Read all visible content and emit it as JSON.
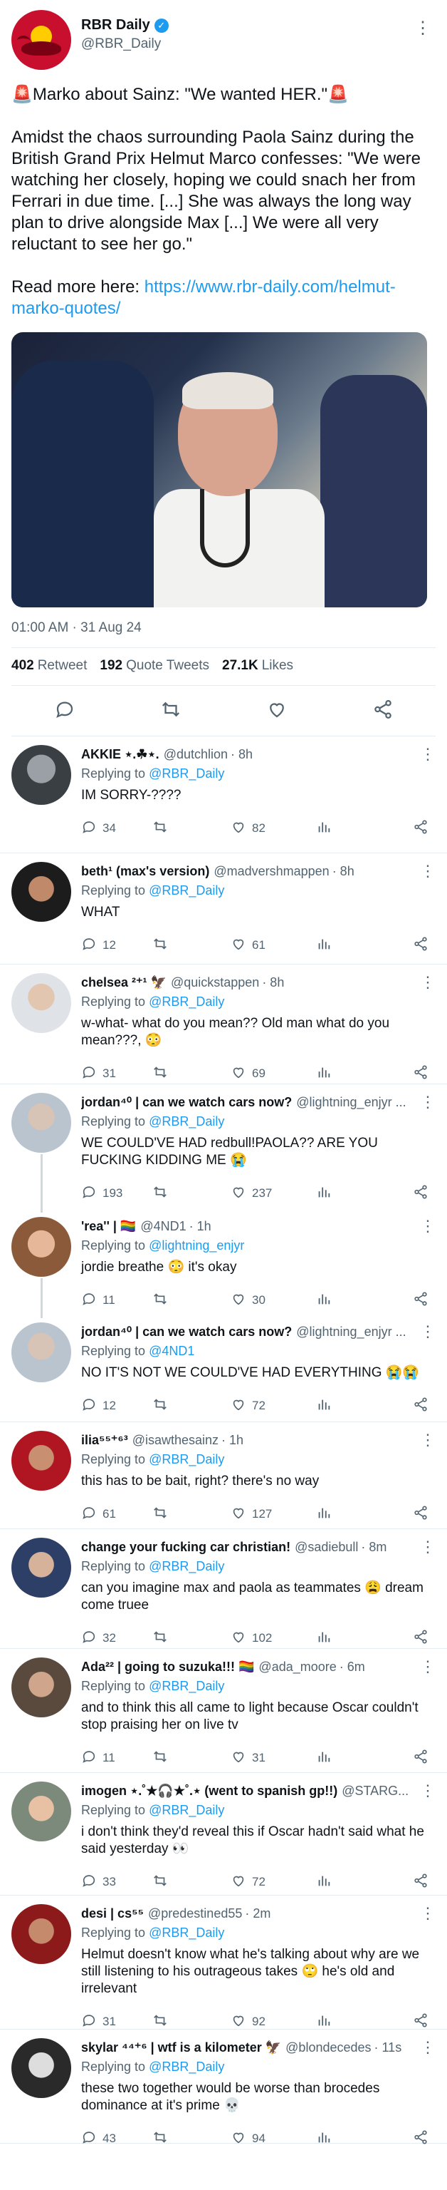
{
  "tweet": {
    "name": "RBR Daily",
    "handle": "@RBR_Daily",
    "title_line": "🚨Marko about Sainz: \"We wanted HER.\"🚨",
    "body": "Amidst the chaos surrounding Paola Sainz during the British Grand Prix Helmut Marco confesses: \"We were watching her closely, hoping we could snach her from Ferrari in due time. [...] She was always the long way plan to drive alongside Max [...] We were all very reluctant to see her go.\"",
    "read_more": "Read more here: ",
    "link": "https://www.rbr-daily.com/helmut-marko-quotes/",
    "timestamp": "01:00 AM · 31 Aug 24",
    "stats": {
      "retweets": "402",
      "retweets_label": "Retweet",
      "quotes": "192",
      "quotes_label": "Quote Tweets",
      "likes": "27.1K",
      "likes_label": "Likes"
    }
  },
  "colors": {
    "accent": "#1d9bf0",
    "muted": "#536471",
    "brand": "#c8102e"
  },
  "replies": [
    {
      "name": "AKKIE ⋆.☘︎⋆.",
      "handle": "@dutchlion",
      "time": "· 8h",
      "replying_prefix": "Replying to ",
      "replying_to": "@RBR_Daily",
      "text": "IM SORRY-????",
      "replies": "34",
      "likes": "82"
    },
    {
      "name": "beth¹ (max's version)",
      "handle": "@madvershmappen",
      "time": "· 8h",
      "replying_prefix": "Replying to ",
      "replying_to": "@RBR_Daily",
      "text": "WHAT",
      "replies": "12",
      "likes": "61"
    },
    {
      "name": "chelsea ²⁺¹ 🦅",
      "handle": "@quickstappen",
      "time": "· 8h",
      "replying_prefix": "Replying to ",
      "replying_to": "@RBR_Daily",
      "text": "w-what- what do you mean?? Old man what do you mean???, 😳",
      "replies": "31",
      "likes": "69"
    },
    {
      "name": "jordan⁴⁰ | can we watch cars now?",
      "handle": "@lightning_enjyr ...",
      "time": "",
      "replying_prefix": "Replying to ",
      "replying_to": "@RBR_Daily",
      "text": "WE COULD'VE HAD redbull!PAOLA?? ARE YOU FUCKING KIDDING ME 😭",
      "replies": "193",
      "likes": "237"
    },
    {
      "name": "'rea'' | 🏳️‍🌈",
      "handle": "@4ND1",
      "time": "· 1h",
      "replying_prefix": "Replying to ",
      "replying_to": "@lightning_enjyr",
      "text": "jordie breathe 😳 it's okay",
      "replies": "11",
      "likes": "30"
    },
    {
      "name": "jordan⁴⁰ | can we watch cars now?",
      "handle": "@lightning_enjyr ...",
      "time": "",
      "replying_prefix": "Replying to ",
      "replying_to": "@4ND1",
      "text": "NO IT'S NOT WE COULD'VE HAD EVERYTHING 😭😭",
      "replies": "12",
      "likes": "72"
    },
    {
      "name": "ilia⁵⁵⁺⁶³",
      "handle": "@isawthesainz",
      "time": "· 1h",
      "replying_prefix": "Replying to ",
      "replying_to": "@RBR_Daily",
      "text": "this has to be bait, right? there's no way",
      "replies": "61",
      "likes": "127"
    },
    {
      "name": "change your fucking car christian!",
      "handle": "@sadiebull",
      "time": "· 8m",
      "replying_prefix": "Replying to ",
      "replying_to": "@RBR_Daily",
      "text": "can you imagine max and paola as teammates 😩 dream come truee",
      "replies": "32",
      "likes": "102"
    },
    {
      "name": "Ada²² | going to suzuka!!! 🏳️‍🌈",
      "handle": "@ada_moore",
      "time": "· 6m",
      "replying_prefix": "Replying to ",
      "replying_to": "@RBR_Daily",
      "text": "and to think this all came to light because Oscar couldn't stop praising her on live tv",
      "replies": "11",
      "likes": "31"
    },
    {
      "name": "imogen ⋆.˚★🎧★˚.⋆ (went to spanish gp!!)",
      "handle": "@STARG...",
      "time": "",
      "replying_prefix": "Replying to ",
      "replying_to": "@RBR_Daily",
      "text": "i don't think they'd reveal this if Oscar hadn't said what he said yesterday 👀",
      "replies": "33",
      "likes": "72"
    },
    {
      "name": "desi | cs⁵⁵",
      "handle": "@predestined55",
      "time": "· 2m",
      "replying_prefix": "Replying to ",
      "replying_to": "@RBR_Daily",
      "text": "Helmut doesn't know what he's talking about why are we still listening to his outrageous takes 🙄 he's old and irrelevant",
      "replies": "31",
      "likes": "92"
    },
    {
      "name": "skylar ⁴⁴⁺⁶ | wtf is a kilometer 🦅",
      "handle": "@blondecedes",
      "time": "· 11s",
      "replying_prefix": "Replying to ",
      "replying_to": "@RBR_Daily",
      "text": "these two together would be worse than brocedes dominance at it's prime 💀",
      "replies": "43",
      "likes": "94"
    }
  ]
}
